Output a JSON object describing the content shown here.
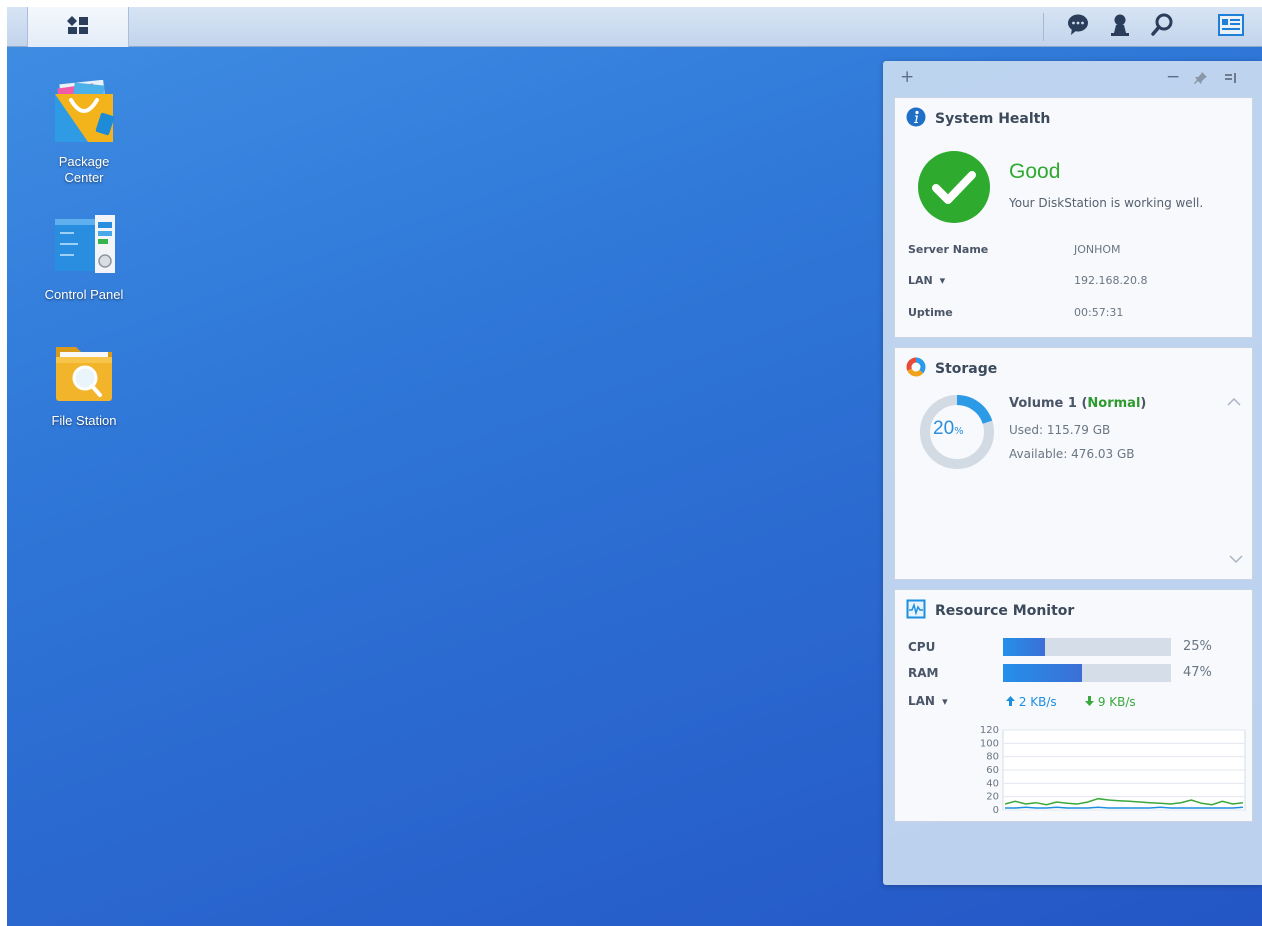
{
  "desktop_icons": [
    {
      "label": "Package Center",
      "icon": "package-center-icon"
    },
    {
      "label": "Control Panel",
      "icon": "control-panel-icon"
    },
    {
      "label": "File Station",
      "icon": "file-station-icon"
    }
  ],
  "taskbar": {
    "left": [
      {
        "icon": "main-menu-icon"
      }
    ],
    "right": [
      {
        "icon": "notifications-icon"
      },
      {
        "icon": "user-icon"
      },
      {
        "icon": "search-icon"
      },
      {
        "icon": "widgets-icon"
      }
    ]
  },
  "widget_toolbar": {
    "add": "+",
    "minimize": "−",
    "pin_icon": "pin-icon",
    "menu_icon": "widget-menu-icon"
  },
  "system_health": {
    "title": "System Health",
    "status": "Good",
    "message": "Your DiskStation is working well.",
    "rows": [
      {
        "label": "Server Name",
        "value": "JONHOM"
      },
      {
        "label": "LAN",
        "value": "192.168.20.8"
      },
      {
        "label": "Uptime",
        "value": "00:57:31"
      }
    ],
    "lan_dropdown_arrow": "▾",
    "colors": {
      "good": "#2eaa2e",
      "info": "#1f6fc7"
    }
  },
  "storage": {
    "title": "Storage",
    "volume_name": "Volume 1 (",
    "volume_status": "Normal",
    "volume_close": ")",
    "used": "Used: 115.79 GB",
    "available": "Available: 476.03 GB",
    "percent": "20",
    "percent_unit": "%",
    "used_fraction": 0.2,
    "colors": {
      "ring": "#2b9be8",
      "track": "#d2dae4",
      "normal": "#2e9a2e"
    }
  },
  "resource_monitor": {
    "title": "Resource Monitor",
    "cpu": {
      "label": "CPU",
      "percent": 25,
      "text": "25%"
    },
    "ram": {
      "label": "RAM",
      "percent": 47,
      "text": "47%"
    },
    "lan": {
      "label": "LAN",
      "arrow": "▾",
      "upload": "2 KB/s",
      "download": "9 KB/s"
    },
    "chart_yticks": [
      "120",
      "100",
      "80",
      "60",
      "40",
      "20",
      "0"
    ],
    "chart_ymax": 120,
    "chart_series": {
      "upload": [
        3,
        3,
        4,
        3,
        3,
        4,
        3,
        3,
        3,
        4,
        3,
        3,
        3,
        3,
        3,
        4,
        3,
        3,
        3,
        3,
        3,
        3,
        3,
        4
      ],
      "download": [
        9,
        13,
        9,
        11,
        8,
        12,
        10,
        9,
        12,
        17,
        15,
        14,
        13,
        12,
        11,
        10,
        9,
        11,
        15,
        10,
        8,
        13,
        9,
        11
      ]
    },
    "colors": {
      "upload": "#1d8fe0",
      "download": "#3aa83a"
    }
  }
}
